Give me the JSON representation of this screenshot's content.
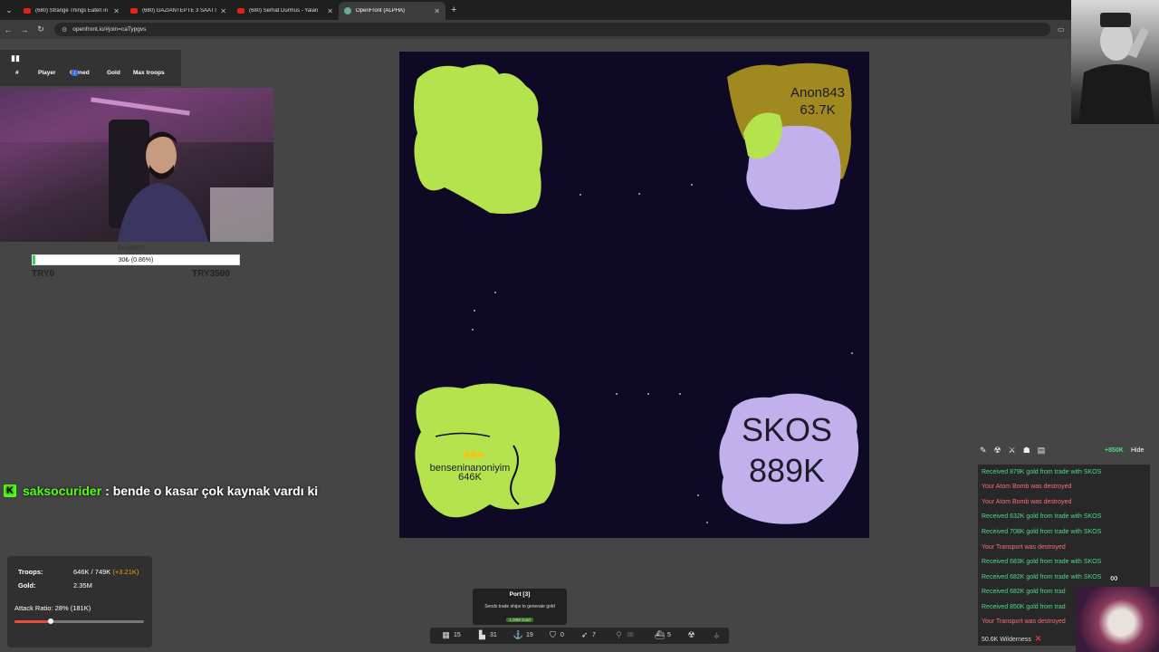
{
  "browser": {
    "tabs": [
      {
        "title": "(680) Strange Things Eaten in I",
        "icon": "youtube-icon"
      },
      {
        "title": "(680) GAZİANTEPTE 3 SAATTE",
        "icon": "youtube-icon"
      },
      {
        "title": "(680) Serhat Durmus - Yalan",
        "icon": "youtube-icon"
      },
      {
        "title": "OpenFront (ALPHA)",
        "icon": "globe-icon"
      }
    ],
    "url": "openfront.io/#join=caTypgvs"
  },
  "leaderboard": {
    "columns": [
      "#",
      "Player",
      "Owned",
      "Gold",
      "Max troops"
    ],
    "owned_badge": "↕"
  },
  "donation": {
    "label": "Kulakkk!!!",
    "bar_text": "30₺ (0.86%)",
    "progress_fraction": 0.0086,
    "min": "TRY0",
    "max": "TRY3500"
  },
  "chat": {
    "username": "saksocurider",
    "message": ": bende o kasar çok kaynak vardı ki"
  },
  "map": {
    "players": [
      {
        "name": "Anon843",
        "troops": "63.7K",
        "color": "#a0891f"
      },
      {
        "name": "SKOS",
        "troops": "889K",
        "color": "#c1b0ec"
      },
      {
        "name": "benseninanoniyim",
        "troops": "646K",
        "color": "#b5e34e"
      }
    ],
    "ocean_color": "#0e0a25"
  },
  "stats": {
    "troops_label": "Troops:",
    "troops_value": "646K / 749K",
    "troops_increase": "(+3.21K)",
    "gold_label": "Gold:",
    "gold_value": "2.35M",
    "attack_ratio_label": "Attack Ratio: 28% (181K)",
    "attack_ratio_fraction": 0.28
  },
  "tooltip": {
    "title": "Port [3]",
    "description": "Sends trade ships to generate gold",
    "cost": "1.00M Gold"
  },
  "build_bar": [
    {
      "icon": "city-icon",
      "count": "15"
    },
    {
      "icon": "factory-icon",
      "count": "31"
    },
    {
      "icon": "port-anchor-icon",
      "count": "19"
    },
    {
      "icon": "defense-shield-icon",
      "count": "0"
    },
    {
      "icon": "missile-icon",
      "count": "7"
    },
    {
      "icon": "silo-icon",
      "count": "38"
    },
    {
      "icon": "warship-icon",
      "count": "5"
    },
    {
      "icon": "nuke-icon",
      "count": ""
    },
    {
      "icon": "mirv-icon",
      "count": ""
    }
  ],
  "events": {
    "gold_rate": "+850K",
    "hide_label": "Hide",
    "items": [
      {
        "text": "Received 879K gold from trade with SKOS",
        "type": "good"
      },
      {
        "text": "Your Atom Bomb was destroyed",
        "type": "bad"
      },
      {
        "text": "Your Atom Bomb was destroyed",
        "type": "bad"
      },
      {
        "text": "Received 632K gold from trade with SKOS",
        "type": "good"
      },
      {
        "text": "Received 708K gold from trade with SKOS",
        "type": "good"
      },
      {
        "text": "Your Transport was destroyed",
        "type": "bad"
      },
      {
        "text": "Received 683K gold from trade with SKOS",
        "type": "good"
      },
      {
        "text": "Received 682K gold from trade with SKOS",
        "type": "good"
      },
      {
        "text": "Received 682K gold from trad",
        "type": "good"
      },
      {
        "text": "Received 850K gold from trad",
        "type": "good"
      },
      {
        "text": "Your Transport was destroyed",
        "type": "bad"
      }
    ],
    "wilderness": "50.6K Wilderness",
    "wilderness_close": "✕"
  },
  "colors": {
    "good": "#4ade80",
    "bad": "#f87171",
    "kick": "#53fc18"
  }
}
